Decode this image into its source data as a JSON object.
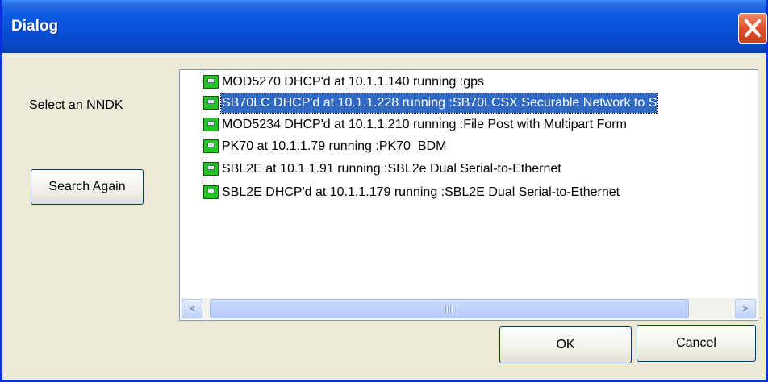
{
  "window": {
    "title": "Dialog"
  },
  "left_panel": {
    "prompt": "Select an NNDK",
    "search_button": "Search Again"
  },
  "device_tree": {
    "items": [
      {
        "label": "MOD5270 DHCP'd at 10.1.1.140 running :gps",
        "selected": false
      },
      {
        "label": "SB70LC DHCP'd at 10.1.1.228 running :SB70LCSX Securable Network to S",
        "selected": true
      },
      {
        "label": "MOD5234 DHCP'd at 10.1.1.210 running :File Post with Multipart Form",
        "selected": false
      },
      {
        "label": "PK70  at 10.1.1.79 running :PK70_BDM",
        "selected": false
      },
      {
        "label": "SBL2E  at 10.1.1.91 running :SBL2e Dual Serial-to-Ethernet",
        "selected": false
      },
      {
        "label": "SBL2E DHCP'd at 10.1.1.179 running :SBL2E Dual Serial-to-Ethernet",
        "selected": false
      }
    ],
    "scrollbar": {
      "left_arrow": "<",
      "right_arrow": ">"
    }
  },
  "footer": {
    "ok_label": "OK",
    "cancel_label": "Cancel"
  },
  "icons": {
    "close": "close-icon",
    "device": "network-device-icon"
  },
  "colors": {
    "title_bar": "#0a4fd5",
    "selection": "#316ac5",
    "close_button": "#e0502c",
    "device_icon": "#21c421"
  }
}
